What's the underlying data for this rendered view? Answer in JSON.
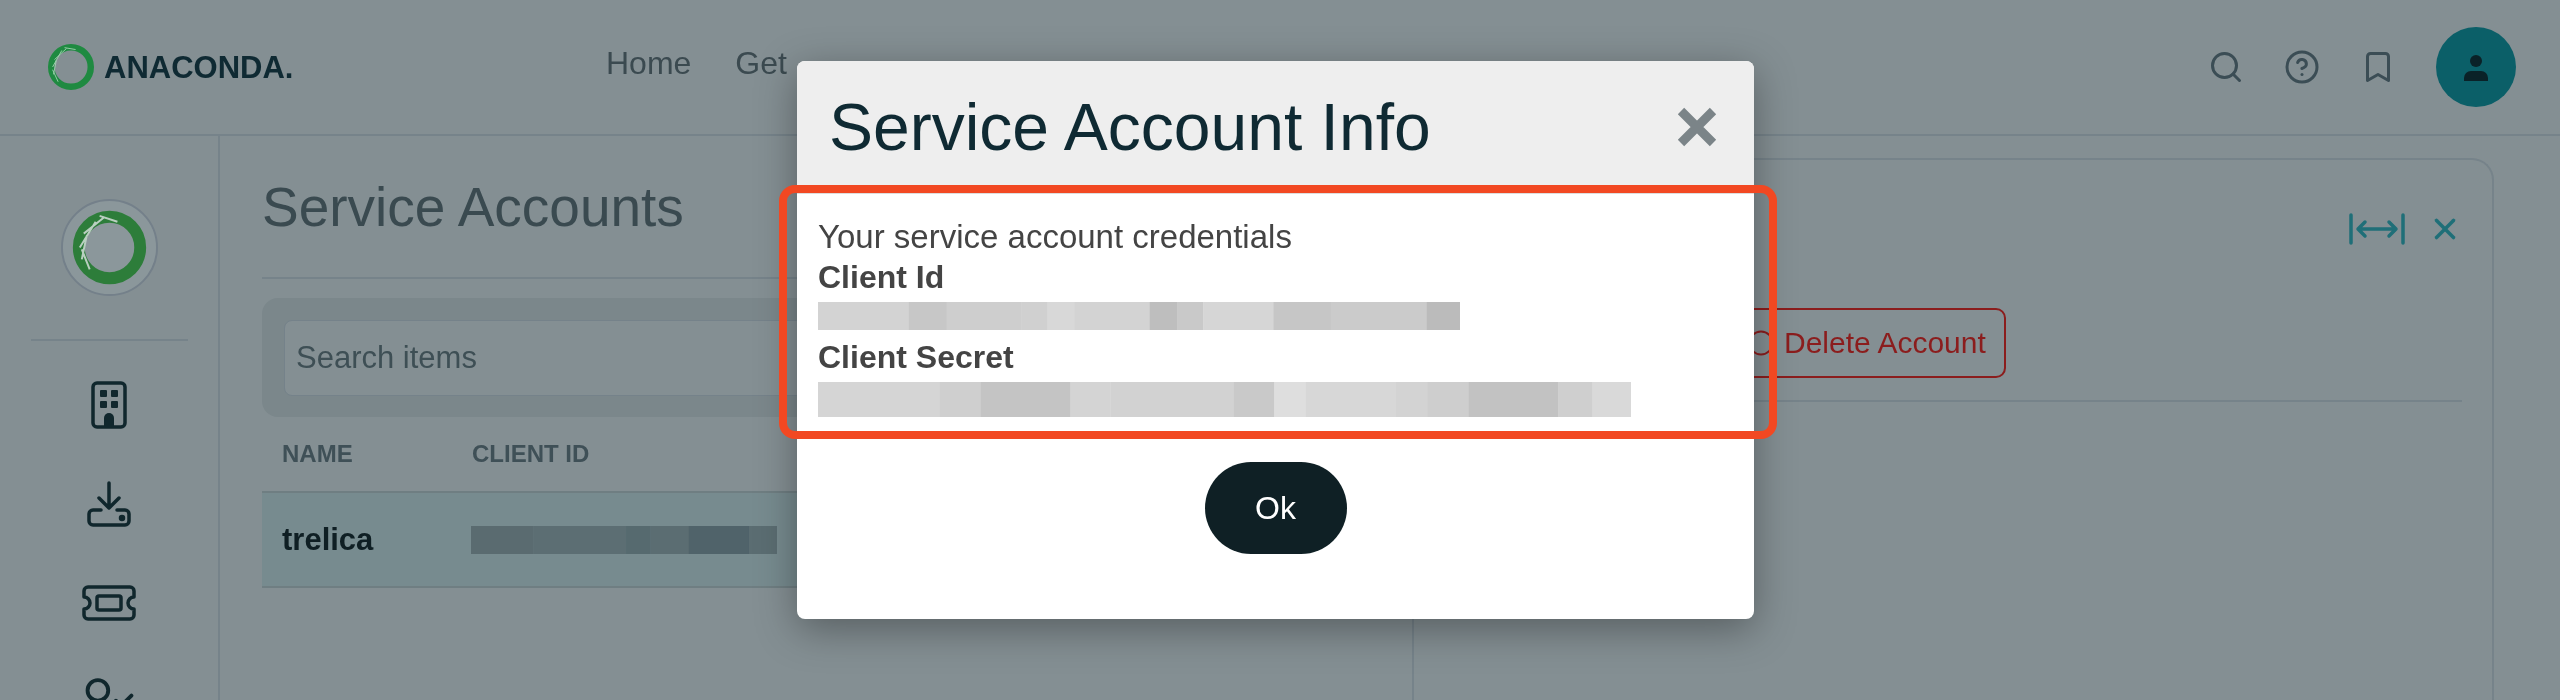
{
  "header": {
    "logo": "ANACONDA.",
    "nav": [
      {
        "label": "Home"
      },
      {
        "label": "Get"
      }
    ]
  },
  "page": {
    "title": "Service Accounts",
    "search": {
      "placeholder": "Search items"
    },
    "table": {
      "columns": [
        "NAME",
        "CLIENT ID"
      ],
      "rows": [
        {
          "name": "trelica",
          "selected": true
        }
      ]
    }
  },
  "detail_panel": {
    "delete_button": {
      "label": "Delete Account"
    }
  },
  "dialog": {
    "title": "Service Account Info",
    "intro": "Your service account credentials",
    "fields": [
      {
        "label": "Client Id"
      },
      {
        "label": "Client Secret"
      }
    ],
    "ok_button": "Ok"
  }
}
